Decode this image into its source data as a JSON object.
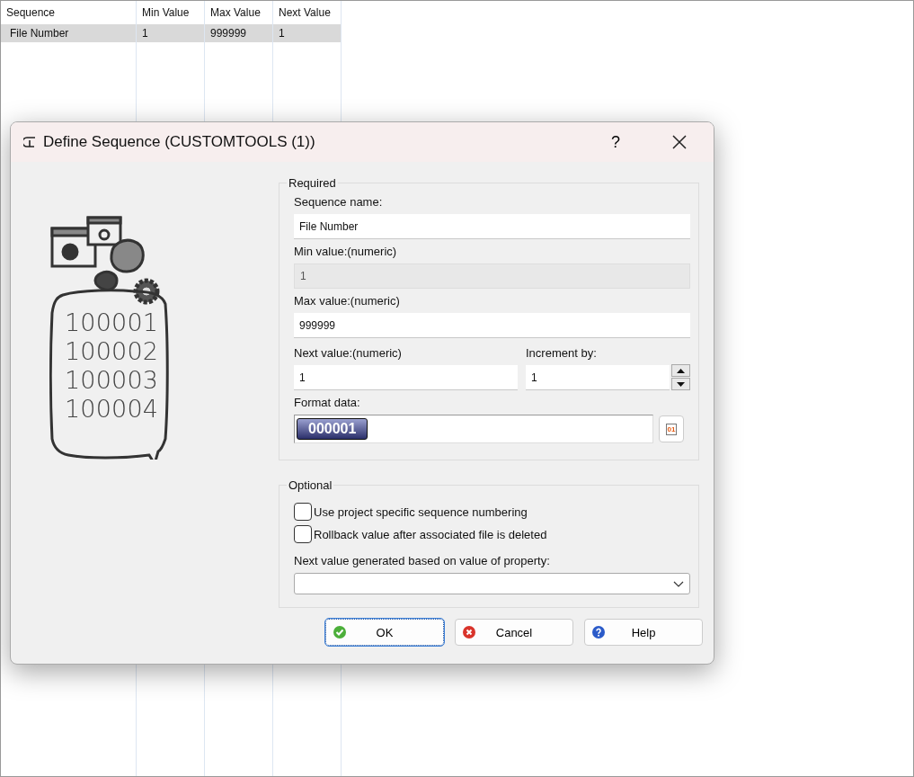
{
  "table": {
    "columns": [
      "Sequence",
      "Min Value",
      "Max Value",
      "Next Value"
    ],
    "rows": [
      {
        "cells": [
          "File Number",
          "1",
          "999999",
          "1"
        ],
        "selected": true
      }
    ]
  },
  "dialog": {
    "title": "Define Sequence (CUSTOMTOOLS (1))",
    "help_glyph": "?",
    "illustration": {
      "lines": [
        "100001",
        "100002",
        "100003",
        "100004"
      ]
    },
    "required": {
      "legend": "Required",
      "sequence_name": {
        "label": "Sequence name:",
        "value": "File Number",
        "disabled": false
      },
      "min_value": {
        "label": "Min value:(numeric)",
        "value": "1",
        "disabled": true
      },
      "max_value": {
        "label": "Max value:(numeric)",
        "value": "999999",
        "disabled": false
      },
      "next_value": {
        "label": "Next value:(numeric)",
        "value": "1",
        "disabled": false
      },
      "increment": {
        "label": "Increment by:",
        "value": "1",
        "disabled": false
      },
      "format_data": {
        "label": "Format data:",
        "token": "000001",
        "button_label": "01"
      }
    },
    "optional": {
      "legend": "Optional",
      "checkboxes": [
        {
          "label": "Use project specific sequence numbering",
          "checked": false
        },
        {
          "label": "Rollback value after associated file is deleted",
          "checked": false
        }
      ],
      "property": {
        "label": "Next value generated based on value of property:"
      }
    },
    "buttons": [
      {
        "label": "OK",
        "kind": "ok",
        "focused": true
      },
      {
        "label": "Cancel",
        "kind": "cancel",
        "focused": false
      },
      {
        "label": "Help",
        "kind": "help",
        "focused": false
      }
    ]
  }
}
